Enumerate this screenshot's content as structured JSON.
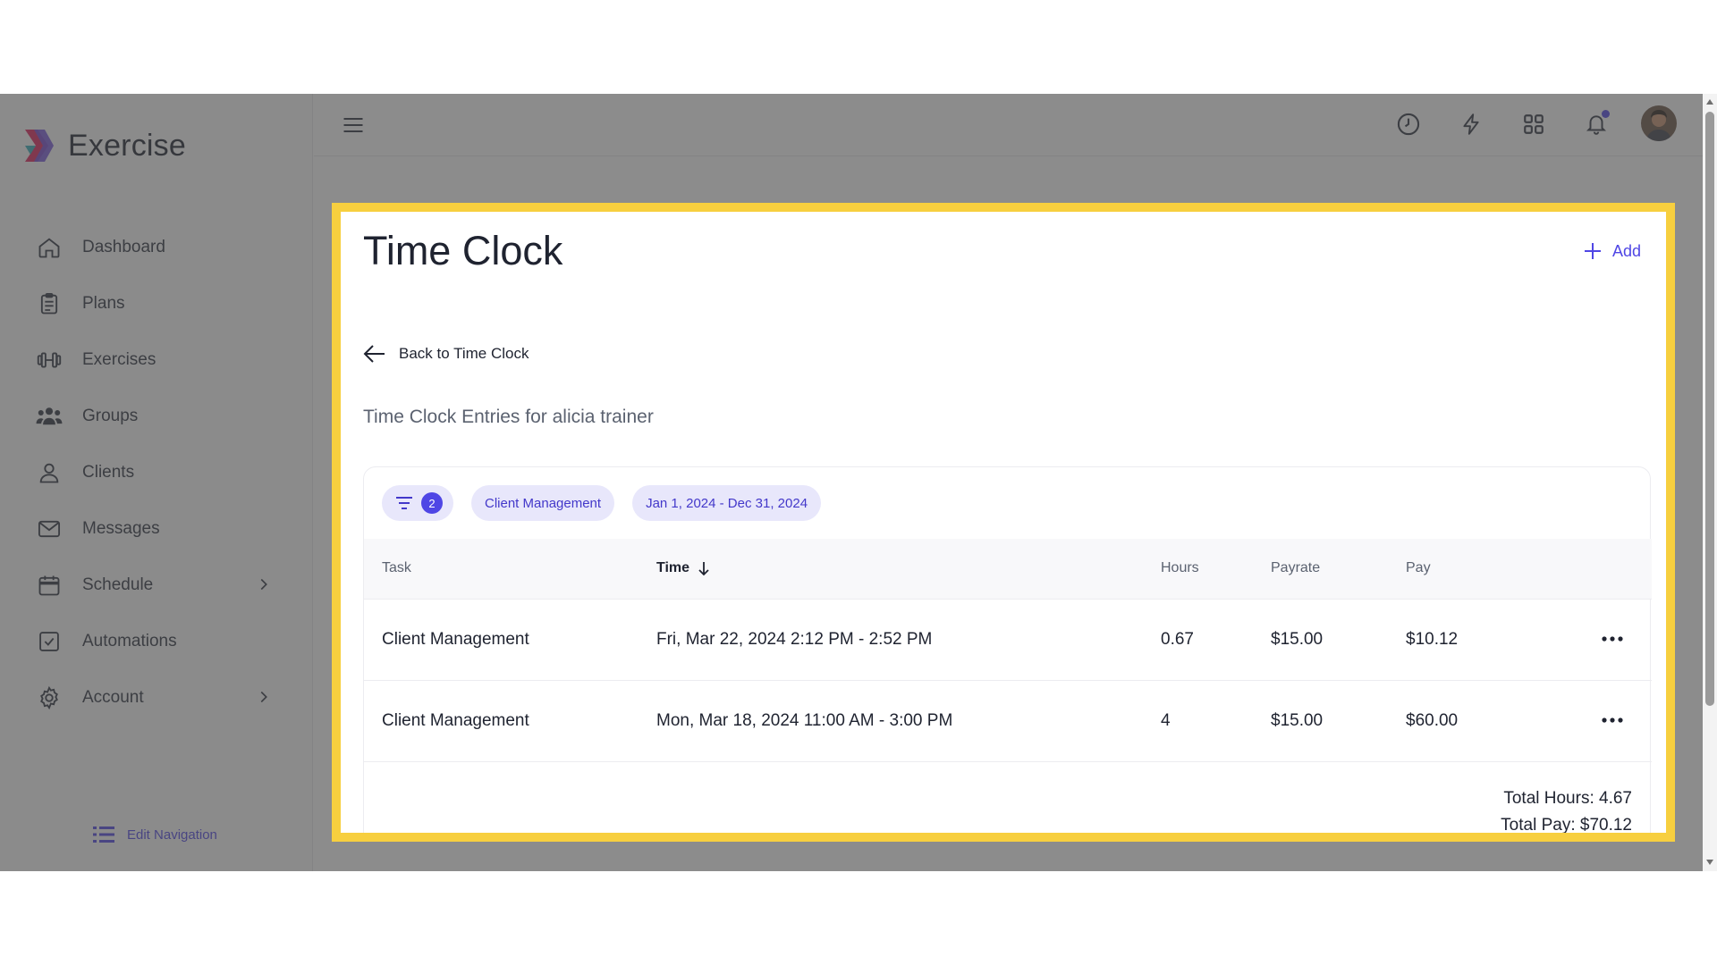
{
  "app": {
    "name": "Exercise",
    "brand_color": "#4f46e5",
    "highlight_color": "#f7cf3f"
  },
  "sidebar": {
    "items": [
      {
        "label": "Dashboard",
        "icon": "home-icon"
      },
      {
        "label": "Plans",
        "icon": "clipboard-icon"
      },
      {
        "label": "Exercises",
        "icon": "dumbbell-icon"
      },
      {
        "label": "Groups",
        "icon": "users-icon"
      },
      {
        "label": "Clients",
        "icon": "user-icon"
      },
      {
        "label": "Messages",
        "icon": "mail-icon"
      },
      {
        "label": "Schedule",
        "icon": "calendar-icon",
        "expandable": true
      },
      {
        "label": "Automations",
        "icon": "checkbox-icon"
      },
      {
        "label": "Account",
        "icon": "gear-icon",
        "expandable": true
      }
    ],
    "edit_navigation": "Edit Navigation"
  },
  "topbar": {
    "icons": [
      "menu-icon",
      "clock-icon",
      "lightning-icon",
      "grid-icon",
      "bell-icon",
      "avatar"
    ]
  },
  "page": {
    "title": "Time Clock",
    "add_label": "Add",
    "back_label": "Back to Time Clock",
    "subtitle": "Time Clock Entries for alicia trainer"
  },
  "filters": {
    "count": "2",
    "chips": [
      "Client Management",
      "Jan 1, 2024 - Dec 31, 2024"
    ]
  },
  "table": {
    "columns": [
      "Task",
      "Time",
      "Hours",
      "Payrate",
      "Pay"
    ],
    "rows": [
      {
        "task": "Client Management",
        "time": "Fri, Mar 22, 2024 2:12 PM - 2:52 PM",
        "hours": "0.67",
        "payrate": "$15.00",
        "pay": "$10.12"
      },
      {
        "task": "Client Management",
        "time": "Mon, Mar 18, 2024 11:00 AM - 3:00 PM",
        "hours": "4",
        "payrate": "$15.00",
        "pay": "$60.00"
      }
    ]
  },
  "totals": {
    "hours": "Total Hours: 4.67",
    "pay": "Total Pay: $70.12"
  }
}
